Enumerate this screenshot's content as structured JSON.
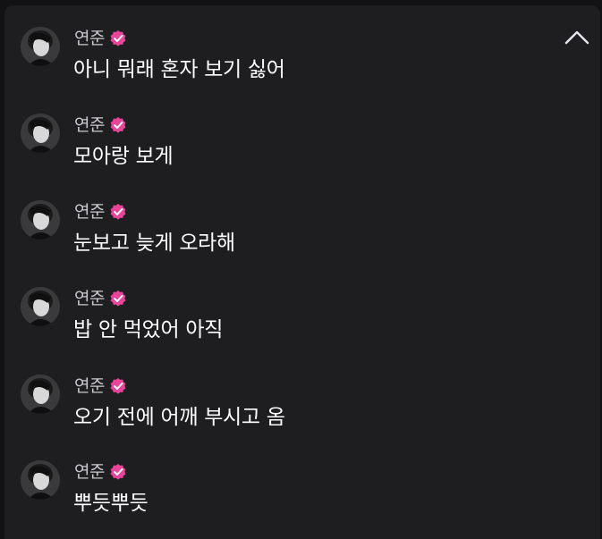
{
  "accent": "#e8449a",
  "messages": [
    {
      "author": "연준",
      "verified": true,
      "text": "아니 뭐래 혼자 보기 싫어"
    },
    {
      "author": "연준",
      "verified": true,
      "text": "모아랑 보게"
    },
    {
      "author": "연준",
      "verified": true,
      "text": "눈보고 늦게 오라해"
    },
    {
      "author": "연준",
      "verified": true,
      "text": "밥 안 먹었어 아직"
    },
    {
      "author": "연준",
      "verified": true,
      "text": "오기 전에 어깨 부시고 옴"
    },
    {
      "author": "연준",
      "verified": true,
      "text": "뿌듯뿌듯"
    }
  ],
  "icons": {
    "collapse": "chevron-up-icon",
    "verified": "verified-badge-icon",
    "avatar": "avatar"
  }
}
